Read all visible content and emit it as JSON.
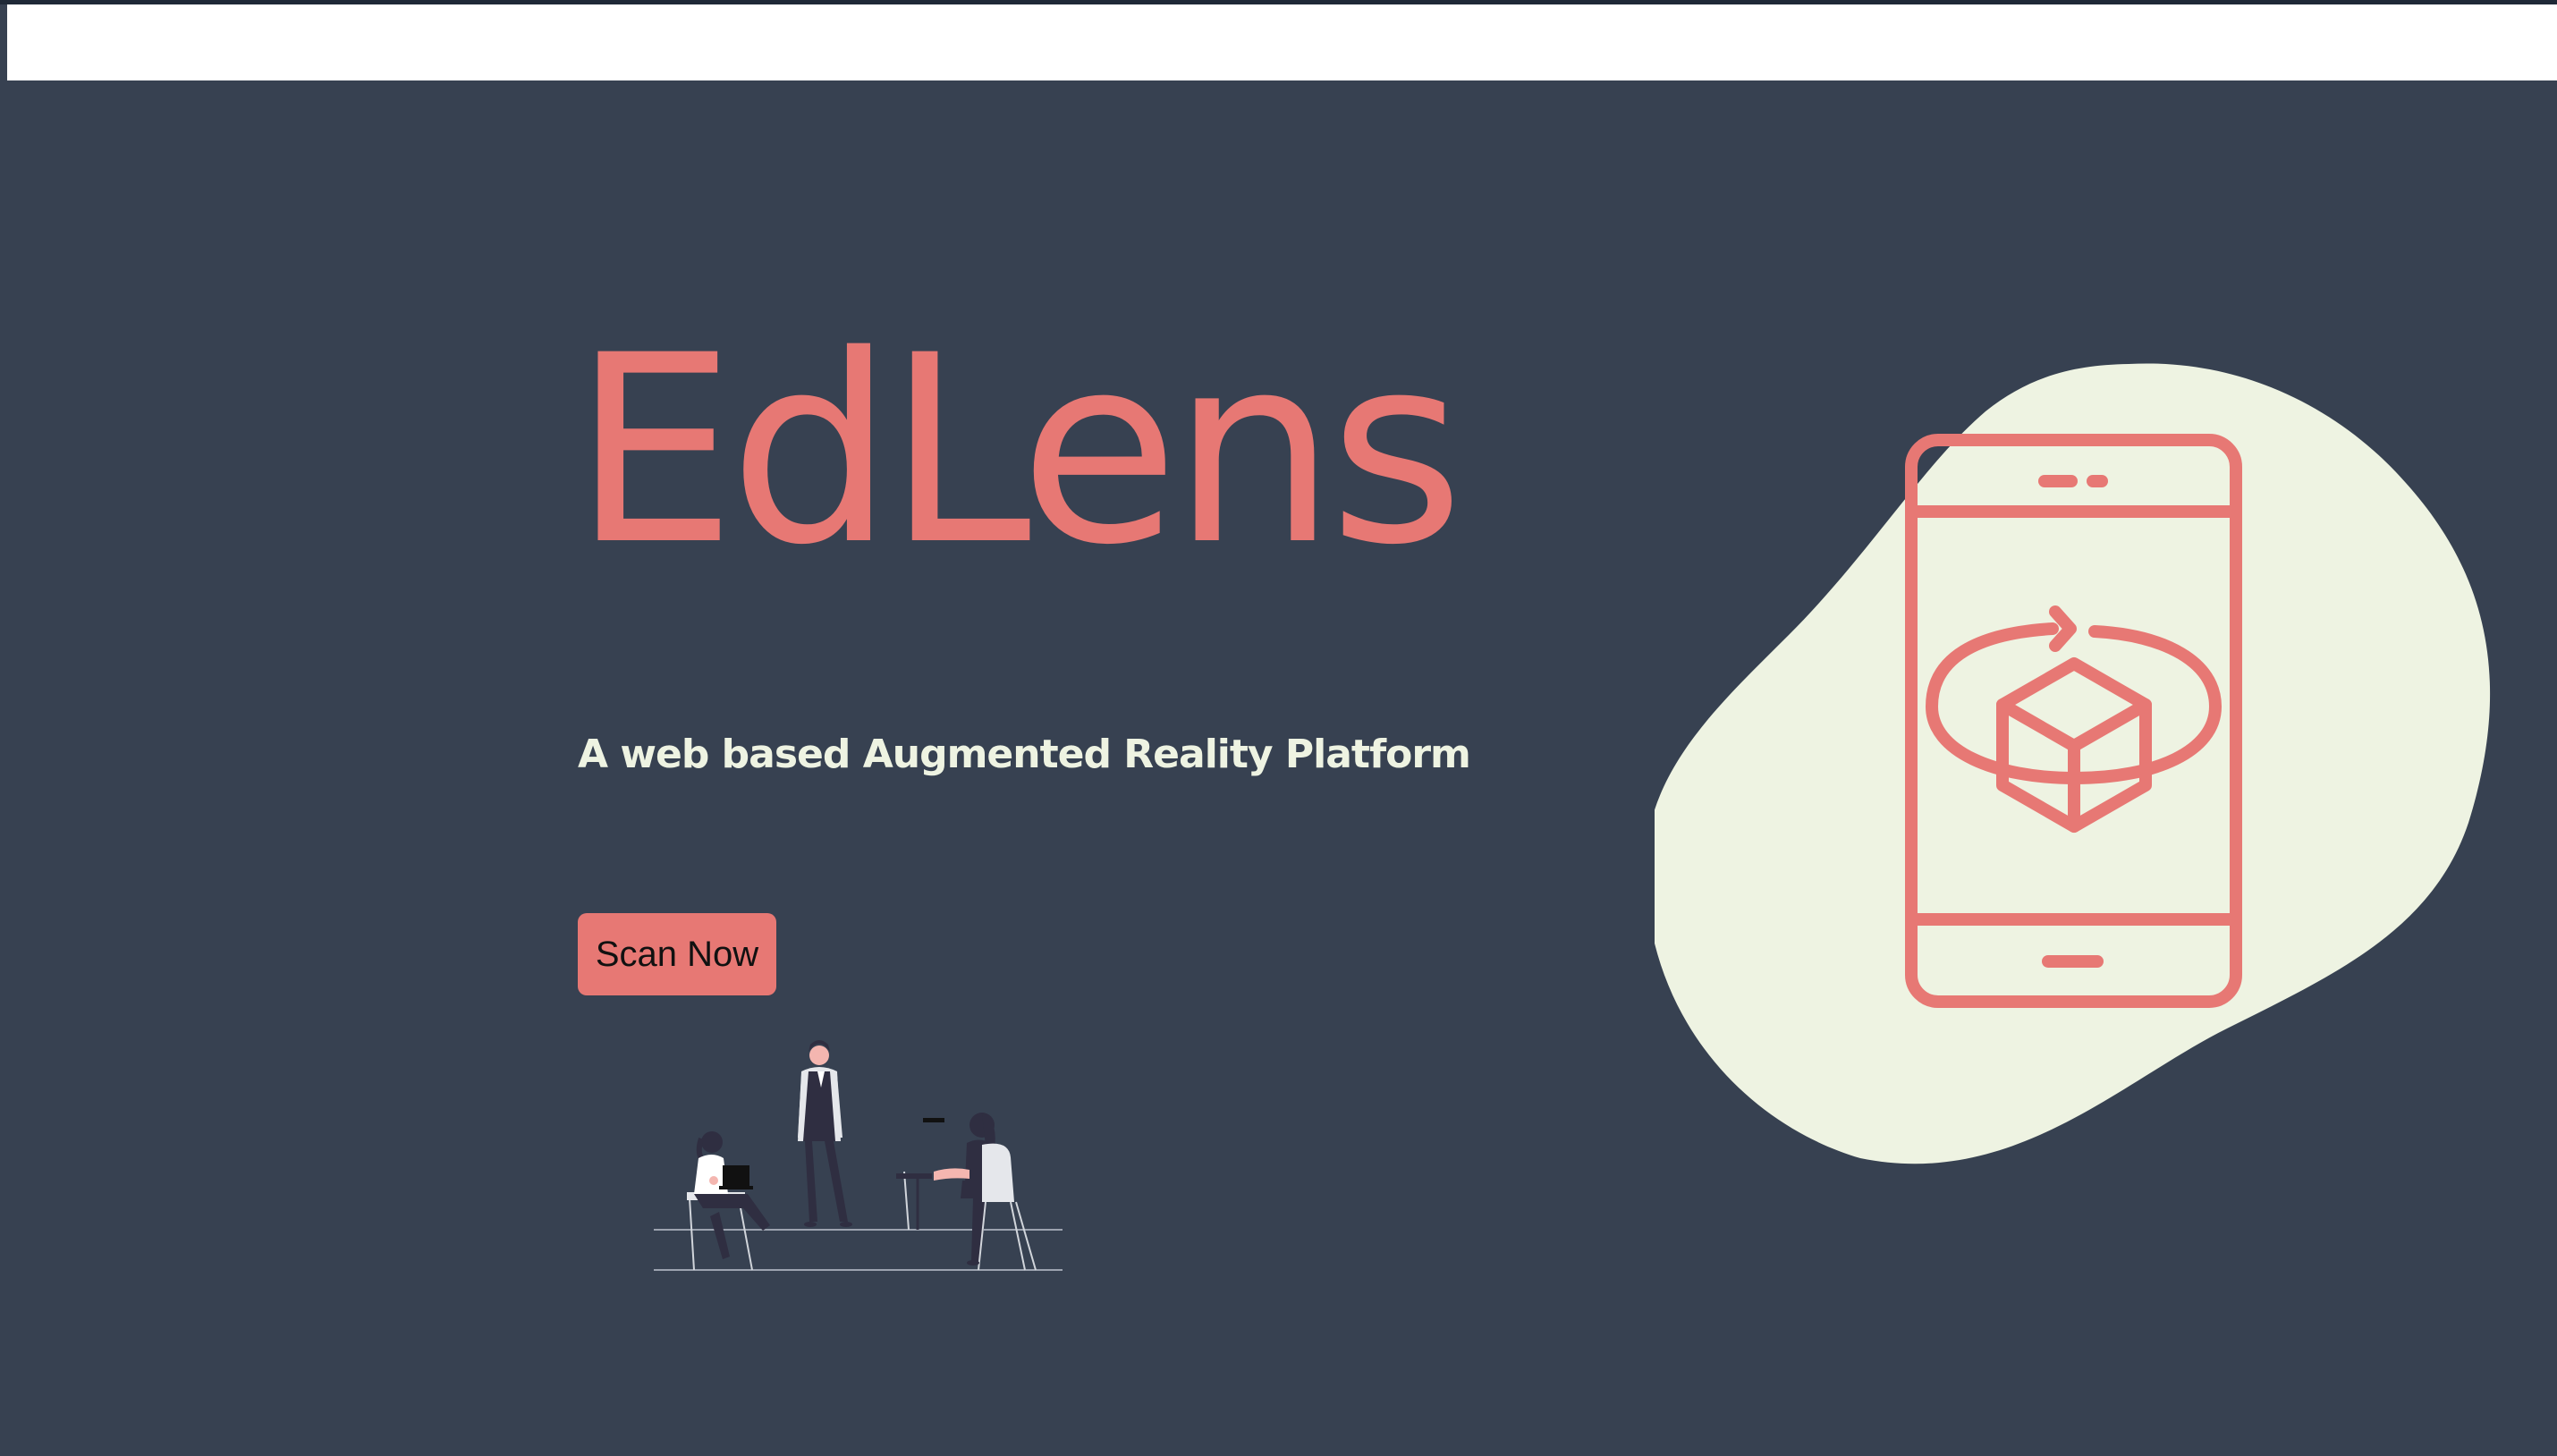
{
  "header": {
    "bar_color": "#ffffff"
  },
  "hero": {
    "title": "EdLens",
    "tagline": "A web based Augmented Reality Platform",
    "cta_label": "Scan Now"
  },
  "colors": {
    "background": "#374151",
    "accent": "#e77874",
    "blob": "#eef3e2",
    "tagline_text": "#eef3e2"
  },
  "icons": {
    "hero_graphic": "phone-ar-cube-icon",
    "illustration": "team-meeting-illustration"
  }
}
